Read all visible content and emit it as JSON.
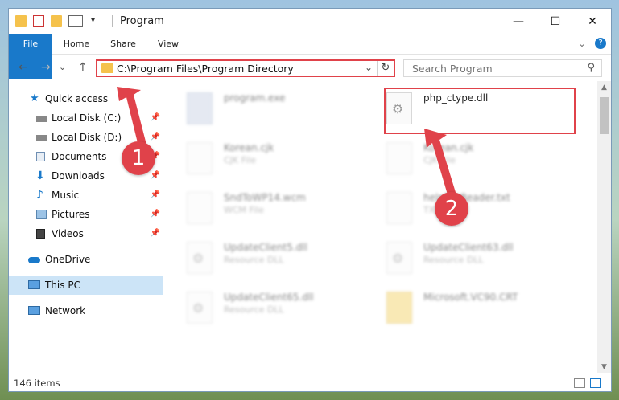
{
  "window": {
    "title": "Program",
    "controls": {
      "minimize": "—",
      "maximize": "☐",
      "close": "✕"
    }
  },
  "ribbon": {
    "tabs": [
      "File",
      "Home",
      "Share",
      "View"
    ],
    "expand": "⌄",
    "help": "?"
  },
  "nav": {
    "back": "←",
    "forward": "→",
    "recent": "⌄",
    "up": "↑",
    "address": "C:\\Program Files\\Program Directory",
    "address_dropdown": "⌄",
    "refresh": "↻",
    "search_placeholder": "Search Program",
    "search_icon": "⚲"
  },
  "sidebar": {
    "items": [
      {
        "label": "Quick access",
        "icon": "star-icon",
        "pinned": false
      },
      {
        "label": "Local Disk (C:)",
        "icon": "drive-icon",
        "pinned": true
      },
      {
        "label": "Local Disk (D:)",
        "icon": "drive-icon",
        "pinned": true
      },
      {
        "label": "Documents",
        "icon": "documents-icon",
        "pinned": true
      },
      {
        "label": "Downloads",
        "icon": "downloads-icon",
        "pinned": true
      },
      {
        "label": "Music",
        "icon": "music-icon",
        "pinned": true
      },
      {
        "label": "Pictures",
        "icon": "pictures-icon",
        "pinned": true
      },
      {
        "label": "Videos",
        "icon": "videos-icon",
        "pinned": true
      },
      {
        "label": "OneDrive",
        "icon": "cloud-icon",
        "pinned": false
      },
      {
        "label": "This PC",
        "icon": "computer-icon",
        "pinned": false,
        "selected": true
      },
      {
        "label": "Network",
        "icon": "network-icon",
        "pinned": false
      }
    ],
    "pin_glyph": "📌"
  },
  "files": [
    {
      "name": "program.exe",
      "type": "",
      "icon": "exe-icon",
      "highlighted": false
    },
    {
      "name": "php_ctype.dll",
      "type": "",
      "icon": "dll-gear-icon",
      "highlighted": true
    },
    {
      "name": "Korean.cjk",
      "type": "CJK File",
      "icon": "file-icon",
      "highlighted": false
    },
    {
      "name": "Korean.cjk",
      "type": "CJK File",
      "icon": "file-icon",
      "highlighted": false
    },
    {
      "name": "SndToWP14.wcm",
      "type": "WCM File",
      "icon": "file-icon",
      "highlighted": false
    },
    {
      "name": "helpFileReader.txt",
      "type": "TXT File",
      "icon": "file-icon",
      "highlighted": false
    },
    {
      "name": "UpdateClient5.dll",
      "type": "Resource DLL",
      "icon": "dll-gear-icon",
      "highlighted": false
    },
    {
      "name": "UpdateClient63.dll",
      "type": "Resource DLL",
      "icon": "dll-gear-icon",
      "highlighted": false
    },
    {
      "name": "UpdateClient65.dll",
      "type": "Resource DLL",
      "icon": "dll-gear-icon",
      "highlighted": false
    },
    {
      "name": "Microsoft.VC90.CRT",
      "type": "",
      "icon": "folder-icon",
      "highlighted": false
    }
  ],
  "status": {
    "count": "146 items"
  },
  "annotations": {
    "step1": "1",
    "step2": "2"
  },
  "colors": {
    "accent": "#1979ca",
    "highlight": "#e0424a",
    "selected": "#cce4f7"
  }
}
